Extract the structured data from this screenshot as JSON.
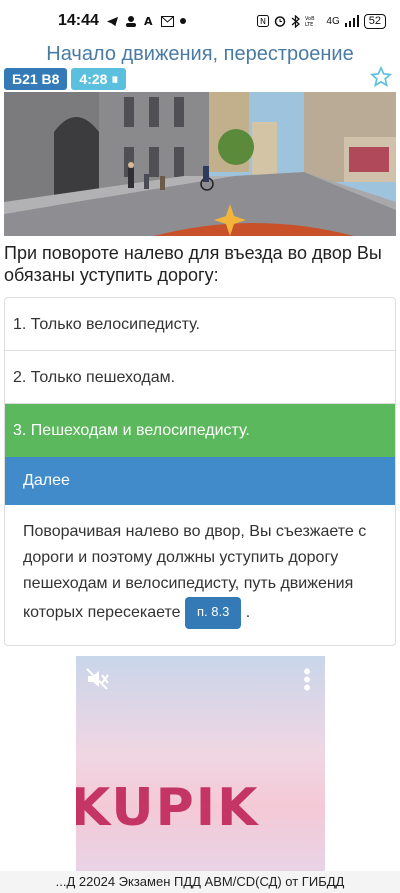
{
  "status_bar": {
    "time": "14:44",
    "icons": [
      "telegram-icon",
      "person-icon",
      "a-icon",
      "mail-icon",
      "dot-icon"
    ],
    "right_icons": [
      "nfc-icon",
      "alarm-icon",
      "bluetooth-icon",
      "volte-icon",
      "signal-icon"
    ],
    "network": "4G",
    "battery": "52"
  },
  "header": {
    "title": "Начало движения, перестроение"
  },
  "badges": {
    "ticket": "Б21 В8",
    "timer": "4:28 ⏸"
  },
  "question": {
    "text": "При повороте налево для въезда во двор Вы обязаны уступить дорогу:"
  },
  "answers": [
    {
      "label": "1. Только велосипедисту.",
      "state": "normal"
    },
    {
      "label": "2. Только пешеходам.",
      "state": "normal"
    },
    {
      "label": "3. Пешеходам и велосипедисту.",
      "state": "correct"
    }
  ],
  "next_button": {
    "label": "Далее"
  },
  "explanation": {
    "text": "Поворачивая налево во двор, Вы съезжаете с дороги и поэтому должны уступить дорогу пешеходам и велосипедисту, путь движения которых пересекаете",
    "rule_ref": "п. 8.3",
    "after": "."
  },
  "ad": {
    "logo_text": "KUPIK"
  },
  "footer": {
    "text": "...Д 22024 Экзамен ПДД ABM/CD(СД) от ГИБДД"
  },
  "colors": {
    "title": "#4a7ba4",
    "ticket_badge": "#337ab7",
    "timer_badge": "#5bc0de",
    "correct": "#5cb85c",
    "next": "#428bca",
    "star": "#5bc0de"
  }
}
